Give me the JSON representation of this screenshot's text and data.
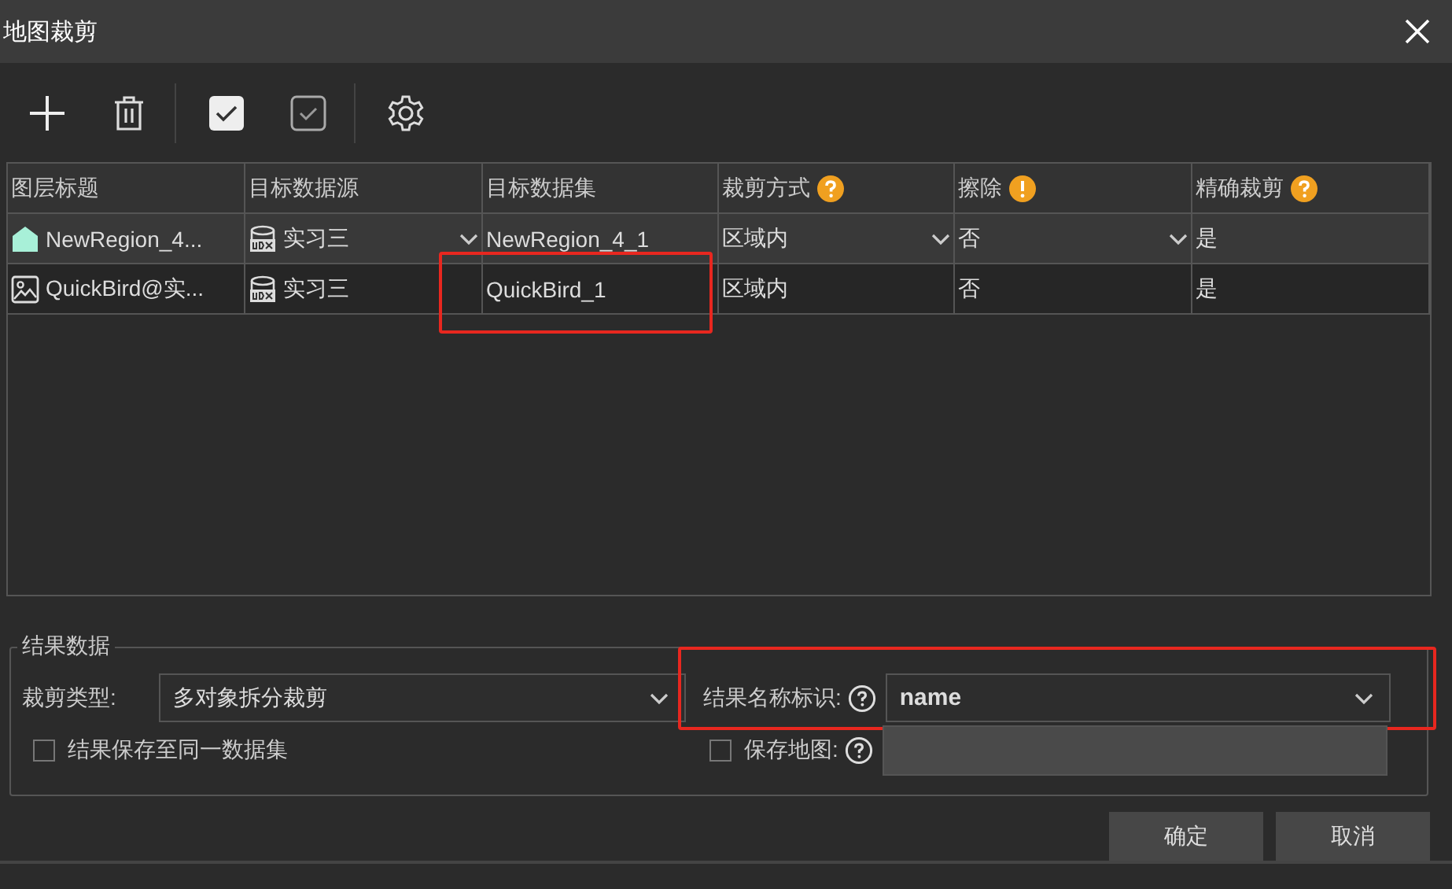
{
  "window": {
    "title": "地图裁剪"
  },
  "toolbar": [
    {
      "kind": "add"
    },
    {
      "kind": "delete"
    },
    {
      "kind": "select_all"
    },
    {
      "kind": "select_none"
    },
    {
      "kind": "settings"
    }
  ],
  "table": {
    "columns": [
      {
        "label": "图层标题",
        "kind": "plain"
      },
      {
        "label": "目标数据源",
        "kind": "plain"
      },
      {
        "label": "目标数据集",
        "kind": "plain"
      },
      {
        "label": "裁剪方式",
        "kind": "help"
      },
      {
        "label": "擦除",
        "kind": "warning"
      },
      {
        "label": "精确裁剪",
        "kind": "help"
      }
    ],
    "rows": [
      {
        "selected": true,
        "cells": [
          {
            "kind": "layer_region",
            "text": "NewRegion_4..."
          },
          {
            "kind": "source_dropdown",
            "text": "实习三"
          },
          {
            "kind": "text",
            "text": "NewRegion_4_1"
          },
          {
            "kind": "dropdown",
            "text": "区域内"
          },
          {
            "kind": "dropdown",
            "text": "否"
          },
          {
            "kind": "text",
            "text": "是"
          }
        ]
      },
      {
        "selected": false,
        "cells": [
          {
            "kind": "layer_image",
            "text": "QuickBird@实..."
          },
          {
            "kind": "source",
            "text": "实习三"
          },
          {
            "kind": "text",
            "text": "QuickBird_1",
            "highlighted": true
          },
          {
            "kind": "text",
            "text": "区域内"
          },
          {
            "kind": "text",
            "text": "否"
          },
          {
            "kind": "text",
            "text": "是"
          }
        ]
      }
    ]
  },
  "results": {
    "title": "结果数据",
    "clip_type": {
      "label": "裁剪类型:",
      "value": "多对象拆分裁剪"
    },
    "result_name": {
      "label": "结果名称标识:",
      "value": "name",
      "highlighted": true
    },
    "same_dataset": {
      "label": "结果保存至同一数据集",
      "checked": false
    },
    "save_map": {
      "label": "保存地图:",
      "checked": false,
      "disabled": true
    }
  },
  "buttons": [
    {
      "label": "确定"
    },
    {
      "label": "取消"
    }
  ]
}
